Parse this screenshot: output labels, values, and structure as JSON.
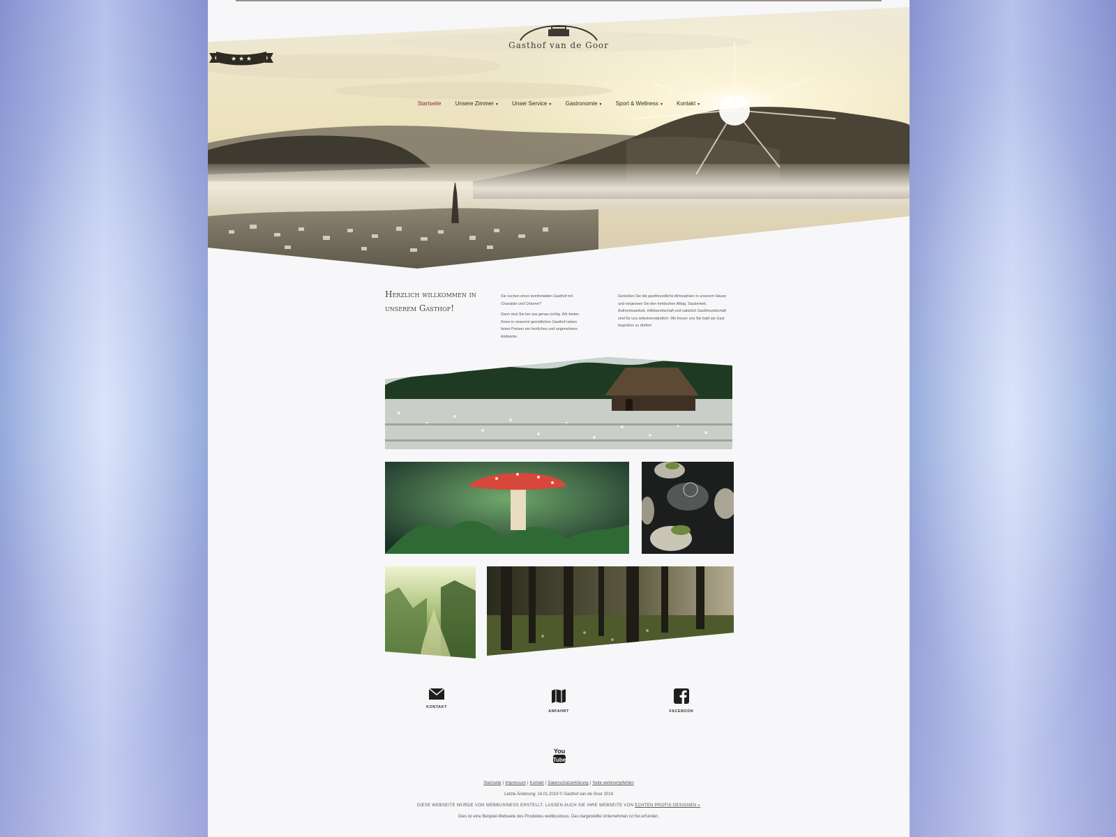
{
  "site": {
    "brand_title": "Gasthof van de Goor",
    "stars": "★ ★ ★"
  },
  "nav": {
    "items": [
      {
        "label": "Startseite",
        "active": true,
        "caret": ""
      },
      {
        "label": "Unsere Zimmer",
        "active": false,
        "caret": "▾"
      },
      {
        "label": "Unser Service",
        "active": false,
        "caret": "▾"
      },
      {
        "label": "Gastronomie",
        "active": false,
        "caret": "▾"
      },
      {
        "label": "Sport & Wellness",
        "active": false,
        "caret": "▾"
      },
      {
        "label": "Kontakt",
        "active": false,
        "caret": "▾"
      }
    ]
  },
  "welcome": {
    "heading": "Herzlich willkommen in unserem Gasthof!",
    "col1_p1": "Sie suchen einen komfortablen Gasthof mit Charakter und Charme?",
    "col1_p2": "Dann sind Sie bei uns genau richtig. Wir bieten Ihnen in unserem gemütlichen Gasthof neben fairen Preisen ein herrliches und angenehmes Ambiente.",
    "col2_p1": "Genießen Sie die gastfreundliche Atmosphäre in unserem Hause und vergessen Sie den hektischen Alltag. Sauberkeit, Aufmerksamkeit, Hilfsbereitschaft und natürlich Gastfreundschaft sind für uns selbstverständlich. Wir freuen uns Sie bald als Gast begrüßen zu dürfen!"
  },
  "icons": {
    "kontakt": "Kontakt",
    "anfahrt": "Anfahrt",
    "facebook": "Facebook",
    "youtube_top": "You",
    "youtube_bottom": "Tube"
  },
  "footer": {
    "links": [
      "Startseite",
      "Impressum",
      "Kontakt",
      "Datenschutzerklärung",
      "Seite weiterempfehlen"
    ],
    "last_change": "Letzte Änderung: 14.01.2019 © Gasthof van de Goor 2019",
    "created_text": "Diese Webseite wurde von webbusiness erstellt. Lassen auch Sie Ihre Webseite von",
    "created_link": "echten Profis designen »",
    "disclaimer": "Dies ist eine Beispiel-Webseite des Produktes webbusiness. Das dargestellte Unternehmen ist frei erfunden."
  },
  "colors": {
    "active_nav": "#8a2a2a",
    "text": "#555555",
    "page_bg": "#f7f7f9"
  }
}
